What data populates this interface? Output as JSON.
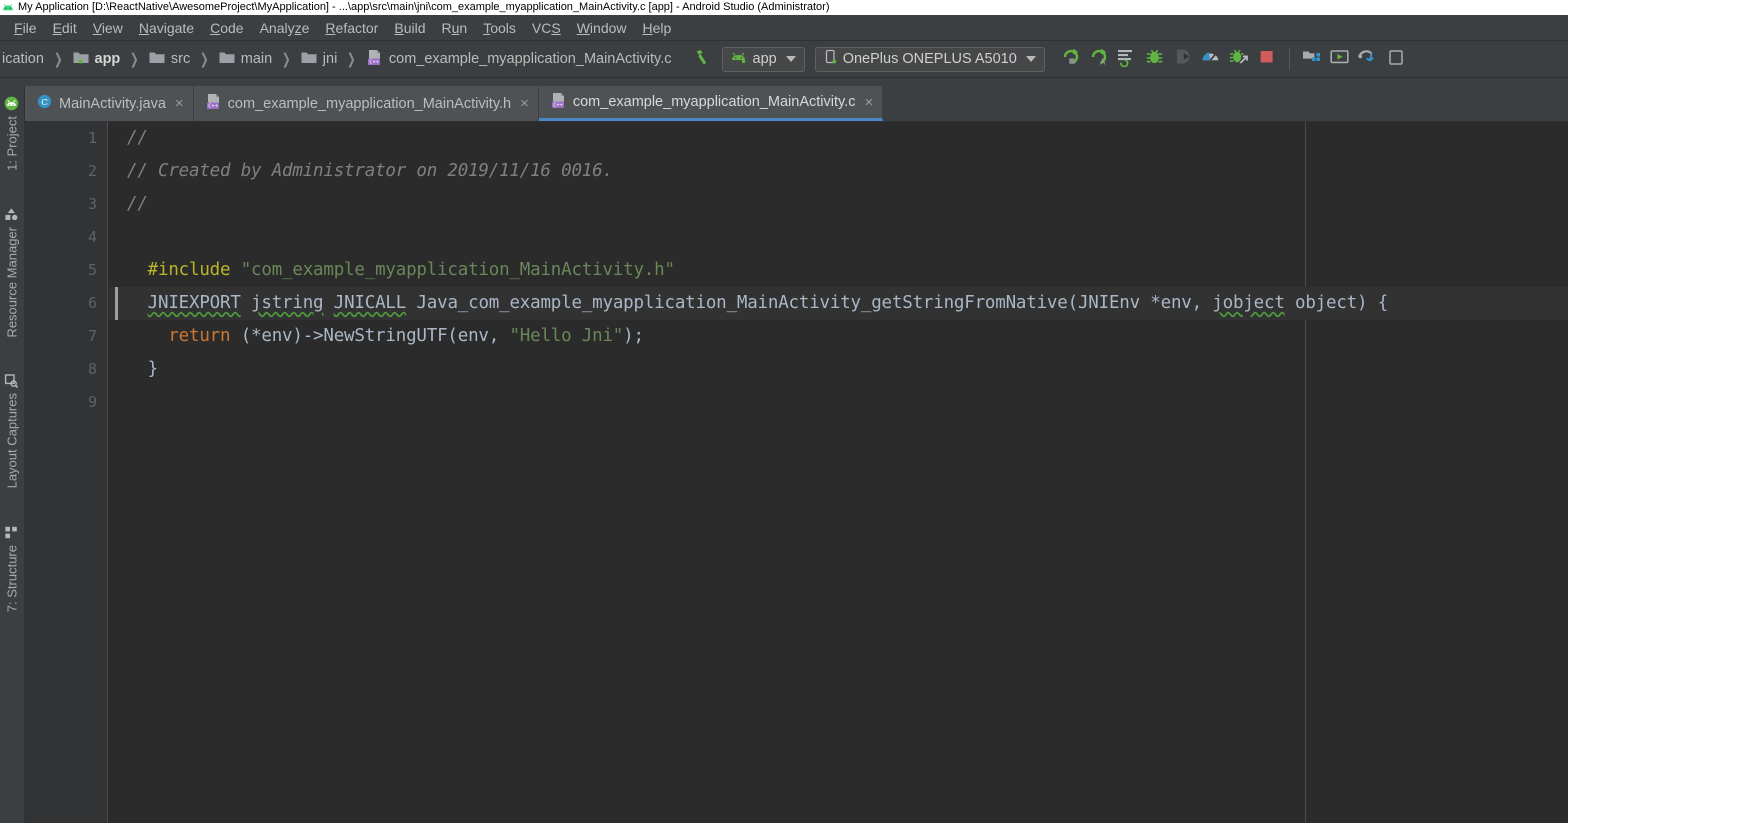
{
  "window": {
    "title": "My Application [D:\\ReactNative\\AwesomeProject\\MyApplication] - ...\\app\\src\\main\\jni\\com_example_myapplication_MainActivity.c [app] - Android Studio (Administrator)",
    "logo_icon": "android-studio-icon"
  },
  "menubar": {
    "items": [
      {
        "label": "File",
        "mnemonic": "F"
      },
      {
        "label": "Edit",
        "mnemonic": "E"
      },
      {
        "label": "View",
        "mnemonic": "V"
      },
      {
        "label": "Navigate",
        "mnemonic": "N"
      },
      {
        "label": "Code",
        "mnemonic": "C"
      },
      {
        "label": "Analyze",
        "mnemonic": "z"
      },
      {
        "label": "Refactor",
        "mnemonic": "R"
      },
      {
        "label": "Build",
        "mnemonic": "B"
      },
      {
        "label": "Run",
        "mnemonic": "u"
      },
      {
        "label": "Tools",
        "mnemonic": "T"
      },
      {
        "label": "VCS",
        "mnemonic": "S"
      },
      {
        "label": "Window",
        "mnemonic": "W"
      },
      {
        "label": "Help",
        "mnemonic": "H"
      }
    ]
  },
  "navbar": {
    "breadcrumbs": [
      {
        "label": "ication",
        "icon": "project-icon",
        "bold": false
      },
      {
        "label": "app",
        "icon": "module-icon",
        "bold": true
      },
      {
        "label": "src",
        "icon": "folder-icon",
        "bold": false
      },
      {
        "label": "main",
        "icon": "folder-icon",
        "bold": false
      },
      {
        "label": "jni",
        "icon": "folder-icon",
        "bold": false
      },
      {
        "label": "com_example_myapplication_MainActivity.c",
        "icon": "c-file-icon",
        "bold": false
      }
    ],
    "build_icon": "hammer-icon",
    "run_config": {
      "label": "app",
      "icon": "android-head-icon",
      "caret": "▾"
    },
    "device": {
      "label": "OnePlus ONEPLUS A5010",
      "icon": "phone-icon",
      "caret": "▾"
    },
    "actions": [
      {
        "name": "run-button",
        "icon": "run-green-icon"
      },
      {
        "name": "apply-changes-button",
        "icon": "apply-changes-icon"
      },
      {
        "name": "run-with-coverage-button",
        "icon": "coverage-icon"
      },
      {
        "name": "debug-button",
        "icon": "debug-bug-icon"
      },
      {
        "name": "attach-debugger-button",
        "icon": "attach-debugger-icon"
      },
      {
        "name": "profiler-button",
        "icon": "profiler-icon"
      },
      {
        "name": "stop-debug-button",
        "icon": "debug-exit-icon"
      },
      {
        "name": "stop-button",
        "icon": "stop-square-icon"
      },
      {
        "name": "sdk-manager-button",
        "icon": "sdk-manager-icon"
      },
      {
        "name": "avd-manager-button",
        "icon": "avd-manager-icon"
      },
      {
        "name": "gradle-sync-button",
        "icon": "gradle-sync-icon"
      },
      {
        "name": "more-button",
        "icon": "more-icon"
      }
    ]
  },
  "left_toolwindows": [
    {
      "label": "1: Project",
      "icon": "project-structure-icon",
      "mnemonic": "1"
    },
    {
      "label": "Resource Manager",
      "icon": "resource-manager-icon",
      "mnemonic": ""
    },
    {
      "label": "Layout Captures",
      "icon": "layout-captures-icon",
      "mnemonic": ""
    },
    {
      "label": "7: Structure",
      "icon": "structure-icon",
      "mnemonic": "7"
    }
  ],
  "editor_tabs": [
    {
      "label": "MainActivity.java",
      "icon": "java-class-icon",
      "active": false,
      "close": "×"
    },
    {
      "label": "com_example_myapplication_MainActivity.h",
      "icon": "h-file-icon",
      "active": false,
      "close": "×"
    },
    {
      "label": "com_example_myapplication_MainActivity.c",
      "icon": "c-file-icon",
      "active": true,
      "close": "×"
    }
  ],
  "editor": {
    "line_numbers": [
      "1",
      "2",
      "3",
      "4",
      "5",
      "6",
      "7",
      "8",
      "9"
    ],
    "current_line": 6,
    "lines": [
      {
        "n": 1,
        "segments": [
          {
            "t": "//",
            "c": "cmt"
          }
        ]
      },
      {
        "n": 2,
        "segments": [
          {
            "t": "// Created by Administrator on 2019/11/16 0016.",
            "c": "cmt"
          }
        ]
      },
      {
        "n": 3,
        "segments": [
          {
            "t": "//",
            "c": "cmt"
          }
        ]
      },
      {
        "n": 4,
        "segments": []
      },
      {
        "n": 5,
        "segments": [
          {
            "t": "  #include ",
            "c": "pre"
          },
          {
            "t": "\"com_example_myapplication_MainActivity.h\"",
            "c": "str"
          }
        ]
      },
      {
        "n": 6,
        "segments": [
          {
            "t": "  ",
            "c": "plain"
          },
          {
            "t": "JNIEXPORT",
            "c": "plain err"
          },
          {
            "t": " ",
            "c": "plain"
          },
          {
            "t": "jstring",
            "c": "plain err"
          },
          {
            "t": " ",
            "c": "plain"
          },
          {
            "t": "JNICALL",
            "c": "plain err"
          },
          {
            "t": " Java_com_example_myapplication_MainActivity_getStringFromNative(JNIEnv *env, ",
            "c": "plain"
          },
          {
            "t": "jobject",
            "c": "plain err"
          },
          {
            "t": " object) {",
            "c": "plain"
          }
        ]
      },
      {
        "n": 7,
        "segments": [
          {
            "t": "    ",
            "c": "plain"
          },
          {
            "t": "return",
            "c": "kw"
          },
          {
            "t": " (*env)->NewStringUTF(env, ",
            "c": "plain"
          },
          {
            "t": "\"Hello Jni\"",
            "c": "str"
          },
          {
            "t": ");",
            "c": "plain"
          }
        ]
      },
      {
        "n": 8,
        "segments": [
          {
            "t": "  }",
            "c": "plain"
          }
        ]
      },
      {
        "n": 9,
        "segments": []
      }
    ]
  },
  "colors": {
    "chrome": "#3c3f41",
    "editor_bg": "#2b2b2b",
    "gutter_bg": "#313335",
    "current_line_bg": "#323232",
    "tab_active_underline": "#4a88c7",
    "comment": "#808080",
    "string": "#6a8759",
    "keyword": "#cc7832",
    "preprocessor": "#bbb529",
    "default_text": "#a9b7c6",
    "accent_green": "#4e9a3d",
    "stop_red": "#d05c5c",
    "profiler_blue": "#3592c4"
  }
}
